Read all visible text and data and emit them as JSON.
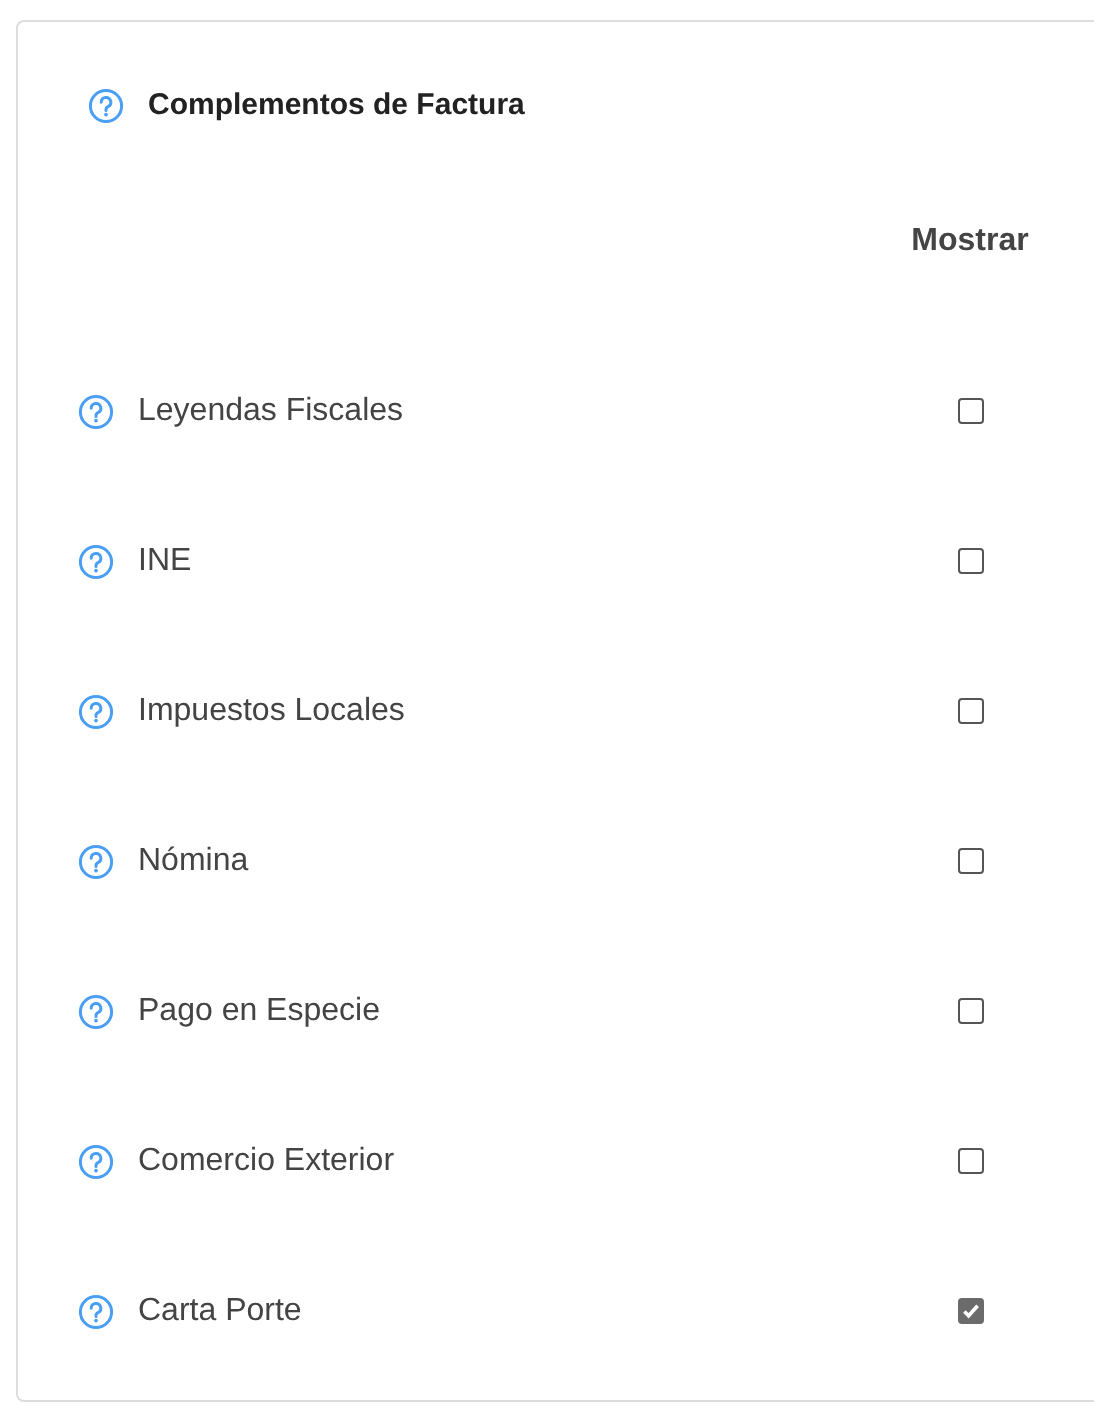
{
  "panel": {
    "title": "Complementos de Factura",
    "column_header": "Mostrar",
    "rows": [
      {
        "label": "Leyendas Fiscales",
        "checked": false
      },
      {
        "label": "INE",
        "checked": false
      },
      {
        "label": "Impuestos Locales",
        "checked": false
      },
      {
        "label": "Nómina",
        "checked": false
      },
      {
        "label": "Pago en Especie",
        "checked": false
      },
      {
        "label": "Comercio Exterior",
        "checked": false
      },
      {
        "label": "Carta Porte",
        "checked": true
      }
    ]
  }
}
